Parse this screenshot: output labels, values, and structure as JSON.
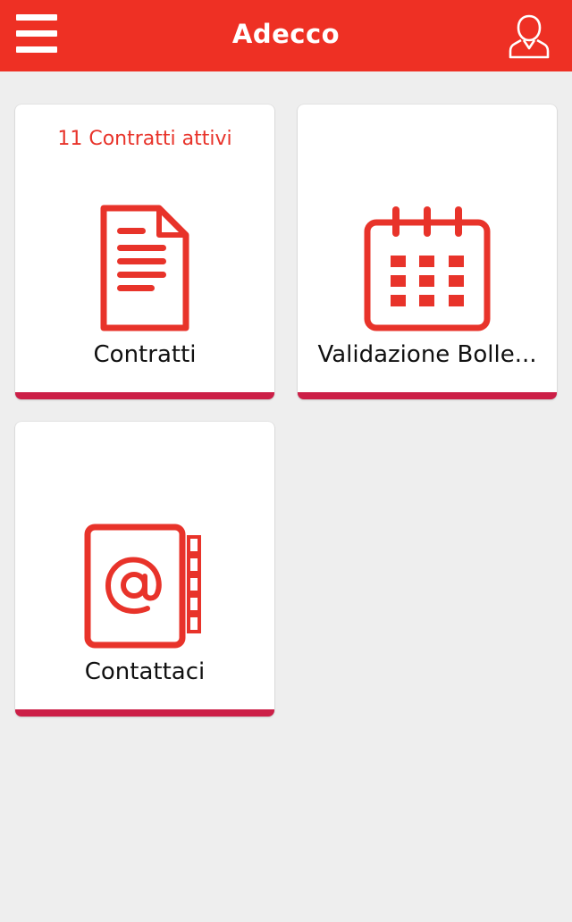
{
  "header": {
    "title": "Adecco",
    "menu_icon": "hamburger-menu-icon",
    "profile_icon": "user-profile-icon",
    "bg_color": "#ee3024"
  },
  "tiles": [
    {
      "label": "Contratti",
      "badge": "11 Contratti attivi",
      "icon": "document-icon"
    },
    {
      "label": "Validazione Bolle...",
      "badge": "",
      "icon": "calendar-icon"
    },
    {
      "label": "Contattaci",
      "badge": "",
      "icon": "address-book-icon"
    }
  ],
  "colors": {
    "accent": "#e8332a",
    "tile_bottom": "#cc1f47",
    "background": "#eeeeee"
  }
}
